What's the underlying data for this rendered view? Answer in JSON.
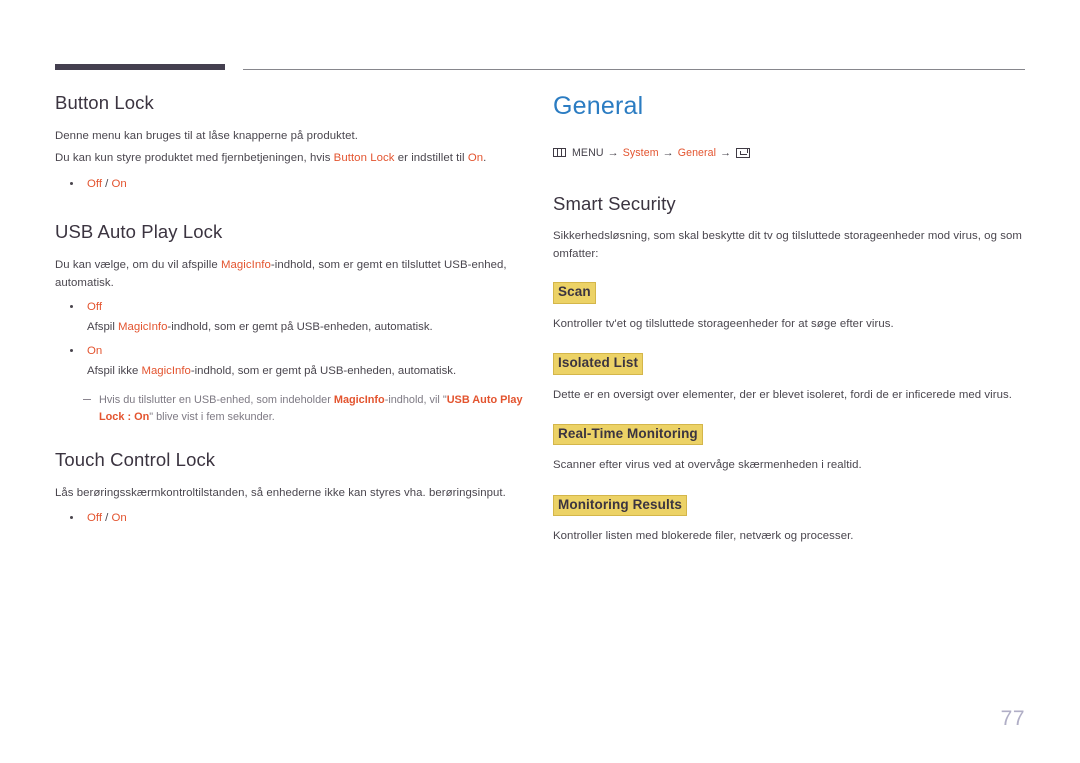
{
  "page": {
    "number": "77"
  },
  "left_column": {
    "sections": [
      {
        "heading": "Button Lock",
        "paragraphs": [
          "Denne menu kan bruges til at låse knapperne på produktet."
        ],
        "sentence_prefix": "Du kan kun styre produktet med fjernbetjeningen, hvis ",
        "sentence_accent1": "Button Lock",
        "sentence_middle": " er indstillet til ",
        "sentence_accent2": "On",
        "sentence_suffix": ".",
        "options": {
          "off": "Off",
          "separator": " / ",
          "on": "On"
        }
      },
      {
        "heading": "USB Auto Play Lock",
        "intro_prefix": "Du kan vælge, om du vil afspille ",
        "intro_accent": "MagicInfo",
        "intro_suffix": "-indhold, som er gemt en tilsluttet USB-enhed, automatisk.",
        "items": [
          {
            "label": "Off",
            "desc_prefix": "Afspil ",
            "desc_accent": "MagicInfo",
            "desc_suffix": "-indhold, som er gemt på USB-enheden, automatisk."
          },
          {
            "label": "On",
            "desc_prefix": "Afspil ikke ",
            "desc_accent": "MagicInfo",
            "desc_suffix": "-indhold, som er gemt på USB-enheden, automatisk."
          }
        ],
        "note": {
          "prefix": "Hvis du tilslutter en USB-enhed, som indeholder ",
          "accent1": "MagicInfo",
          "middle": "-indhold, vil \"",
          "accent2": "USB Auto Play Lock : On",
          "suffix": "\" blive vist i fem sekunder."
        }
      },
      {
        "heading": "Touch Control Lock",
        "paragraphs": [
          "Lås berøringsskærmkontroltilstanden, så enhederne ikke kan styres vha. berøringsinput."
        ],
        "options": {
          "off": "Off",
          "separator": " / ",
          "on": "On"
        }
      }
    ]
  },
  "right_column": {
    "chapter_title": "General",
    "breadcrumb": {
      "menu_icon": "menu-grid-icon",
      "menu_label": "MENU",
      "arrow": "→",
      "item1": "System",
      "item2": "General",
      "enter_icon": "enter-key-icon"
    },
    "section_heading": "Smart Security",
    "section_intro": "Sikkerhedsløsning, som skal beskytte dit tv og tilsluttede storageenheder mod virus, og som omfatter:",
    "subsections": [
      {
        "title": "Scan",
        "desc": "Kontroller tv'et og tilsluttede storageenheder for at søge efter virus."
      },
      {
        "title": "Isolated List",
        "desc": "Dette er en oversigt over elementer, der er blevet isoleret, fordi de er inficerede med virus."
      },
      {
        "title": "Real-Time Monitoring",
        "desc": "Scanner efter virus ved at overvåge skærmenheden i realtid."
      },
      {
        "title": "Monitoring Results",
        "desc": "Kontroller listen med blokerede filer, netværk og processer."
      }
    ]
  },
  "colors": {
    "accent_orange": "#e3542f",
    "chapter_blue": "#2b7cc2",
    "highlight_yellow": "#ecd266",
    "highlight_border": "#d4b64a",
    "heading_dark": "#3b3440",
    "body_gray": "#4a464e",
    "note_gray": "#7e7a84",
    "page_number_gray": "#b0aec6",
    "header_bar_dark": "#443f4f",
    "header_rule_gray": "#86868c"
  }
}
